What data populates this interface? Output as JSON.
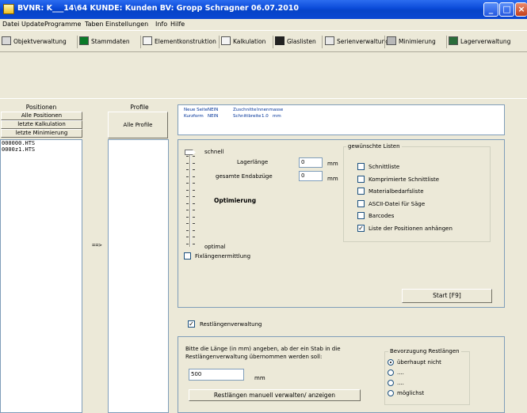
{
  "window": {
    "title": "BVNR: K___14\\64  KUNDE: Kunden  BV: Gropp Schragner 06.07.2010"
  },
  "menu": [
    "Datei",
    "Update",
    "Programme",
    "Taben",
    "Einstellungen",
    "Info",
    "Hilfe"
  ],
  "toolbar": [
    "Objektverwaltung",
    "Stammdaten",
    "Elementkonstruktion",
    "Kalkulation",
    "Glaslisten",
    "Serienverwaltung",
    "Minimierung",
    "Lagerverwaltung"
  ],
  "left": {
    "positionen_header": "Positionen",
    "profile_header": "Profile",
    "btn_alle_positionen": "Alle Positionen",
    "btn_letzte_kalkulation": "letzte Kalkulation",
    "btn_letzte_minimierung": "letzte Minimierung",
    "btn_alle_profile": "Alle Profile",
    "transfer": "==>",
    "items": [
      "000000.HTS",
      "0000z1.HTS"
    ]
  },
  "info": {
    "neue_seite_label": "Neue Seite",
    "neue_seite_value": "NEIN",
    "zuschnitte_label": "Zuschnitte",
    "zuschnitte_value": "Innenmasse",
    "kurzform_label": "Kurzform",
    "kurzform_value": "NEIN",
    "schnittbreite_label": "Schnittbreite",
    "schnittbreite_value": "1.0",
    "schnittbreite_unit": "mm"
  },
  "optim": {
    "schnell": "schnell",
    "lagerlaenge_label": "Lagerlänge",
    "lagerlaenge_value": "0",
    "unit": "mm",
    "endabzuege_label": "gesamte Endabzüge",
    "endabzuege_value": "0",
    "optimierung": "Optimierung",
    "optimal": "optimal",
    "fixlaengen_label": "Fixlängenermittlung",
    "fixlaengen_checked": false
  },
  "listen": {
    "title": "gewünschte Listen",
    "items": [
      {
        "label": "Schnittliste",
        "checked": false
      },
      {
        "label": "Komprimierte Schnittliste",
        "checked": false
      },
      {
        "label": "Materialbedarfsliste",
        "checked": false
      },
      {
        "label": "ASCII-Datei für Säge",
        "checked": false
      },
      {
        "label": "Barcodes",
        "checked": false
      },
      {
        "label": "Liste der Positionen anhängen",
        "checked": true
      }
    ]
  },
  "start_button": "Start   [F9]",
  "rest": {
    "checkbox_label": "Restlängenverwaltung",
    "checked": true,
    "instruction_1": "Bitte die Länge (in mm) angeben, ab der ein Stab in die",
    "instruction_2": "Restlängenverwaltung übernommen werden soll:",
    "value": "500",
    "unit": "mm",
    "manual_button": "Restlängen manuell verwalten/ anzeigen",
    "bevorzugung_title": "Bevorzugung Restlängen",
    "options": [
      {
        "label": "überhaupt nicht",
        "selected": true
      },
      {
        "label": "....",
        "selected": false
      },
      {
        "label": "....",
        "selected": false
      },
      {
        "label": "möglichst",
        "selected": false
      }
    ]
  }
}
